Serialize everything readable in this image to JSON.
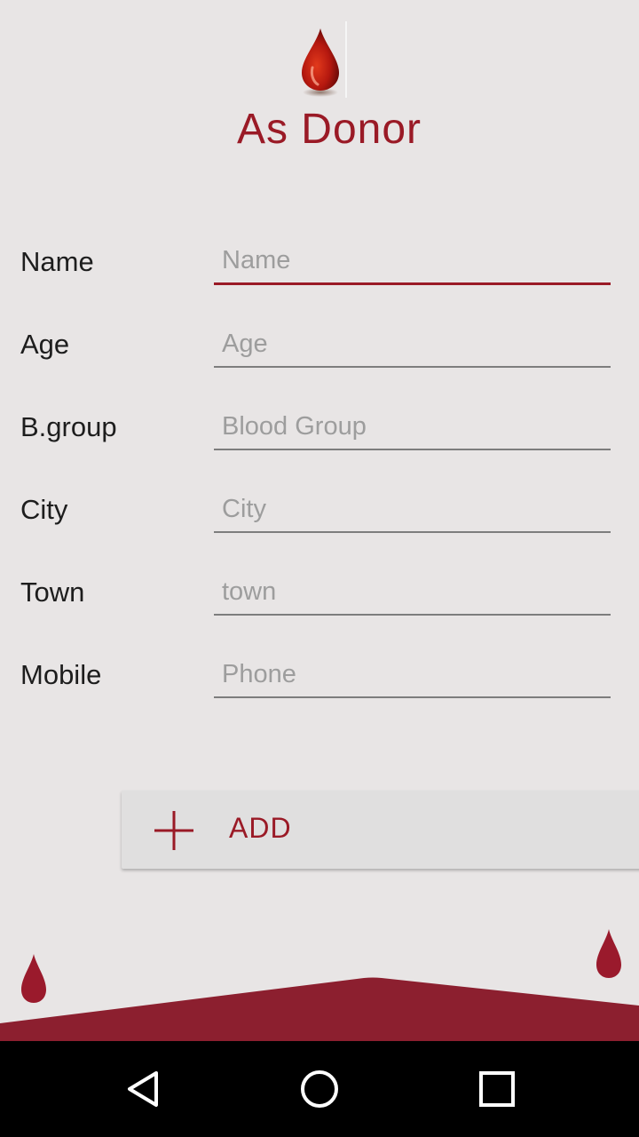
{
  "header": {
    "title": "As Donor",
    "logo_icon": "blood-drop-icon"
  },
  "form": {
    "fields": [
      {
        "label": "Name",
        "placeholder": "Name",
        "value": ""
      },
      {
        "label": "Age",
        "placeholder": "Age",
        "value": ""
      },
      {
        "label": "B.group",
        "placeholder": "Blood Group",
        "value": ""
      },
      {
        "label": "City",
        "placeholder": "City",
        "value": ""
      },
      {
        "label": "Town",
        "placeholder": "town",
        "value": ""
      },
      {
        "label": "Mobile",
        "placeholder": "Phone",
        "value": ""
      }
    ],
    "focused_field": "Name"
  },
  "actions": {
    "add_label": "ADD",
    "add_icon": "plus-icon"
  },
  "decor": {
    "icons": [
      "blood-drop-icon",
      "blood-drop-icon"
    ]
  },
  "navbar": {
    "icons": [
      "back-icon",
      "home-icon",
      "recents-icon"
    ]
  },
  "colors": {
    "accent": "#9a1a26",
    "background": "#e8e5e5",
    "navbar": "#000000",
    "wave": "#8c1f2f"
  }
}
